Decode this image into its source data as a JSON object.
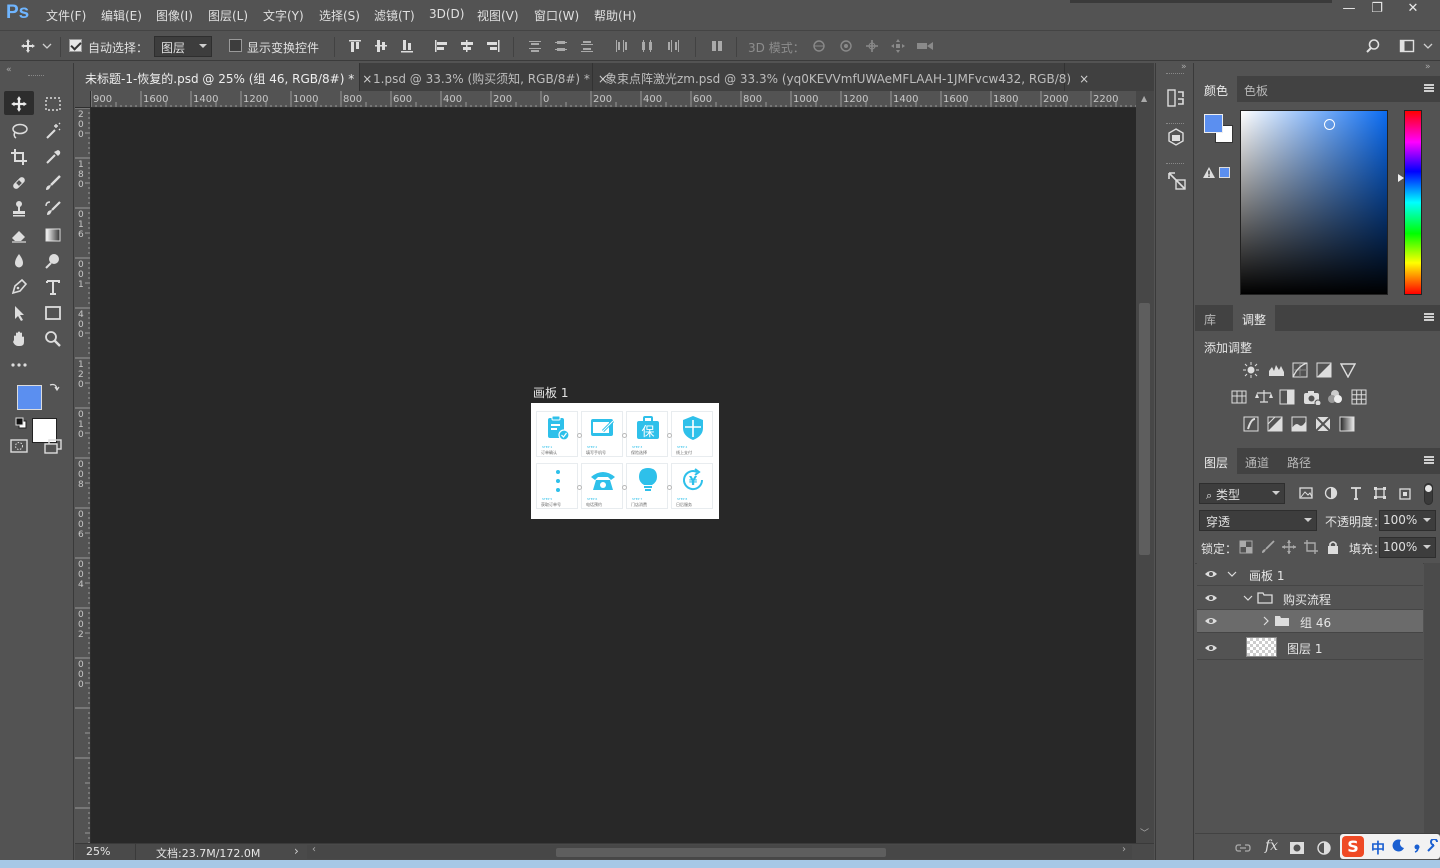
{
  "app": {
    "logo": "Ps"
  },
  "menu": [
    "文件(F)",
    "编辑(E)",
    "图像(I)",
    "图层(L)",
    "文字(Y)",
    "选择(S)",
    "滤镜(T)",
    "3D(D)",
    "视图(V)",
    "窗口(W)",
    "帮助(H)"
  ],
  "window_controls": {
    "minimize": "—",
    "restore": "❐",
    "close": "✕"
  },
  "options": {
    "auto_select_label": "自动选择：",
    "auto_select_value": "图层",
    "show_transform_label": "显示变换控件",
    "mode_3d_label": "3D 模式："
  },
  "tabs": [
    {
      "title": "未标题-1-恢复的.psd @ 25% (组 46, RGB/8#) *",
      "close": "×"
    },
    {
      "title": "1.psd @ 33.3% (购买须知, RGB/8#) *",
      "close": "×"
    },
    {
      "title": "象束点阵激光zm.psd @ 33.3% (yq0KEVVmfUWAeMFLAAH-1JMFvcw432, RGB/8)",
      "close": "×"
    }
  ],
  "ruler_h": [
    "900",
    "1600",
    "1400",
    "1200",
    "1000",
    "800",
    "600",
    "400",
    "200",
    "0",
    "200",
    "400",
    "600",
    "800",
    "1000",
    "1200",
    "1400",
    "1600",
    "1800",
    "2000",
    "2200"
  ],
  "ruler_v": [
    "2",
    "0",
    "0",
    "1",
    "8",
    "0",
    "0",
    "1",
    "6",
    "0",
    "0",
    "1",
    "4",
    "0",
    "0",
    "1",
    "2",
    "0",
    "0",
    "1",
    "0",
    "0",
    "0",
    "8",
    "0",
    "0",
    "6",
    "0",
    "0",
    "4",
    "0",
    "0",
    "2",
    "0",
    "0",
    "0"
  ],
  "artboard": {
    "title": "画板 1",
    "cells": [
      {
        "step": "STEP 1",
        "label": "订单确认"
      },
      {
        "step": "STEP 2",
        "label": "填写手机号"
      },
      {
        "step": "STEP 3",
        "label": "保险选择"
      },
      {
        "step": "STEP 4",
        "label": "线上支付"
      },
      {
        "step": "STEP 5",
        "label": "获取订单号"
      },
      {
        "step": "STEP 6",
        "label": "电话预约"
      },
      {
        "step": "STEP 7",
        "label": "门店消费"
      },
      {
        "step": "STEP 8",
        "label": "日后服务"
      }
    ],
    "bao_char": "保",
    "yen_char": "¥"
  },
  "status": {
    "zoom": "25%",
    "doc": "文档:23.7M/172.0M",
    "arrow": "›"
  },
  "color_panel": {
    "tabs": [
      "颜色",
      "色板"
    ],
    "fg_color": "#5b8ff0",
    "hue_color": "#0b6cf2"
  },
  "adjust_panel": {
    "tabs": [
      "库",
      "调整"
    ],
    "title": "添加调整"
  },
  "layers_panel": {
    "tabs": [
      "图层",
      "通道",
      "路径"
    ],
    "filter_label": "类型",
    "blend_mode": "穿透",
    "opacity_label": "不透明度：",
    "opacity_value": "100%",
    "lock_label": "锁定：",
    "fill_label": "填充：",
    "fill_value": "100%",
    "layers": [
      {
        "name": "画板 1"
      },
      {
        "name": "购买流程"
      },
      {
        "name": "组 46"
      },
      {
        "name": "图层 1"
      }
    ],
    "bottom_fx": "fx"
  },
  "ime": {
    "logo": "S",
    "lang": "中"
  }
}
